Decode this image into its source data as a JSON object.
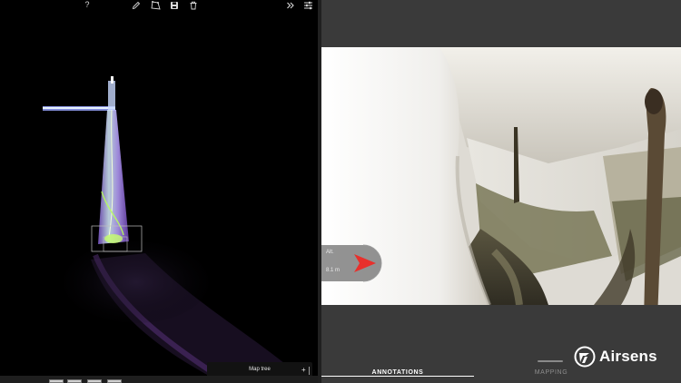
{
  "toolbar": {
    "help_label": "?",
    "icons": [
      "pencil-icon",
      "polygon-icon",
      "save-icon",
      "trash-icon",
      "double-chevron-right-icon",
      "sliders-icon"
    ]
  },
  "viewer": {
    "map_tree_label": "Map tree",
    "map_tree_add": "+"
  },
  "compass": {
    "label": "Alt.",
    "value": "8.1 m"
  },
  "tabs": [
    {
      "label": "ANNOTATIONS",
      "active": true
    },
    {
      "label": "MAPPING",
      "active": false
    }
  ],
  "brand": {
    "name": "Airsens"
  },
  "colors": {
    "background": "#000000",
    "panel": "#3a3a3a",
    "compass_arrow": "#e8302c",
    "pointcloud_green": "#b8ff5a",
    "pointcloud_violet": "#a070ff"
  }
}
